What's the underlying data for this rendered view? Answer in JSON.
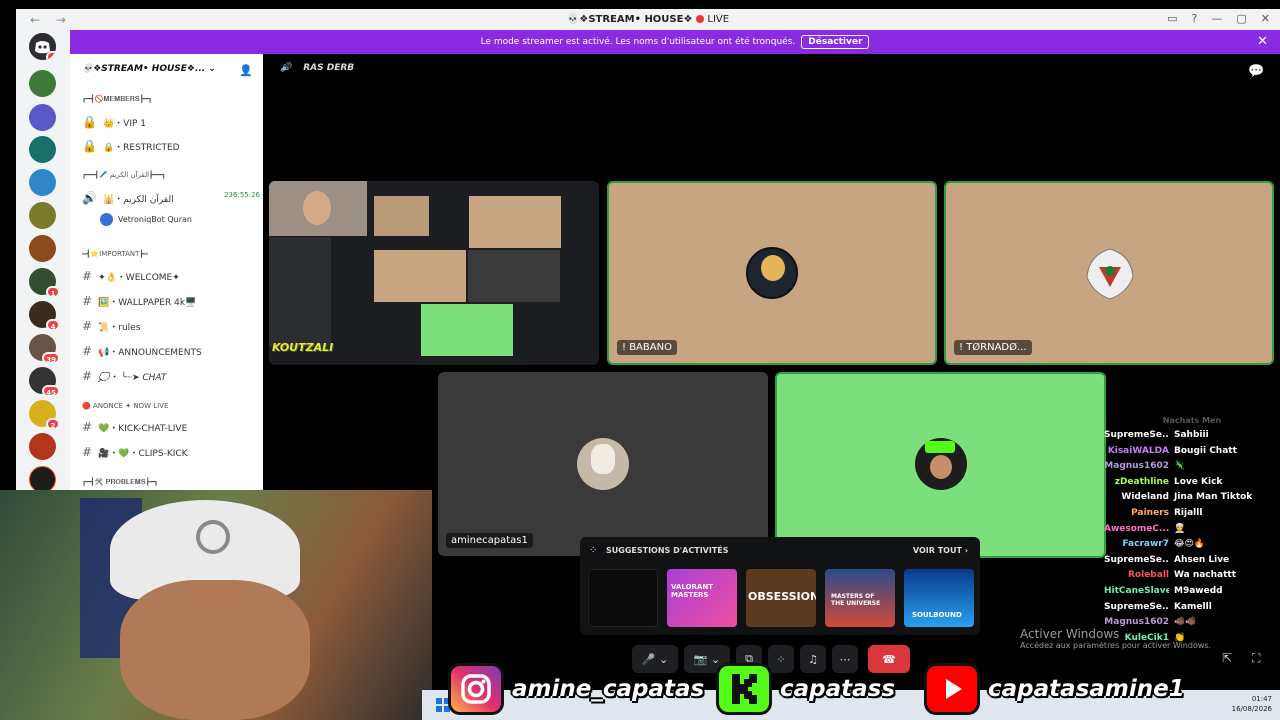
{
  "window": {
    "title": "💀❖STREAM• HOUSE❖",
    "live_label": "LIVE"
  },
  "banner": {
    "text": "Le mode streamer est activé. Les noms d'utilisateur ont été tronqués.",
    "button": "Désactiver"
  },
  "rail": {
    "badges": [
      "1",
      "1",
      "4",
      "39",
      "45",
      "2"
    ]
  },
  "server": {
    "name": "💀❖STREAM• HOUSE❖..."
  },
  "channels": [
    {
      "type": "category",
      "label": "┏━┫🚫𝐌𝐄𝐌𝐁𝐄𝐑𝐒┣━┓"
    },
    {
      "type": "locked",
      "label": "👑・VIP 1"
    },
    {
      "type": "locked",
      "label": "🔒・RESTRICTED"
    },
    {
      "type": "category",
      "label": "┏━━┫🖊️ القرآن الكريم┣━━┓"
    },
    {
      "type": "voice",
      "label": "🕌・القرآن الكريم",
      "timer": "236:55:26"
    },
    {
      "type": "member",
      "label": "VetroniqBot Quran"
    },
    {
      "type": "category",
      "label": "═┫⭐IMPORTANT┣═"
    },
    {
      "type": "text",
      "label": "✦👌・WELCOME✦"
    },
    {
      "type": "text",
      "label": "🖼️・WALLPAPER 4k🖥️"
    },
    {
      "type": "text",
      "label": "📜・rules"
    },
    {
      "type": "text",
      "label": "📢・ANNOUNCEMENTS"
    },
    {
      "type": "text",
      "label": "💭・ ╰┈➤ CHAT"
    },
    {
      "type": "category",
      "label": "🔴 ANONCE ✦ NOW LIVE"
    },
    {
      "type": "text",
      "label": "💚・KICK-CHAT-LIVE"
    },
    {
      "type": "text",
      "label": "🎥・💚・CLIPS-KICK"
    },
    {
      "type": "category",
      "label": "┏━┫🛠️ 𝐏𝐑𝐎𝐁𝐋𝐄𝐌𝐒┣━┓"
    }
  ],
  "voice": {
    "channel_name": "RAS DERB",
    "participants": [
      {
        "name": "! BABANO"
      },
      {
        "name": "! TØRNADØ..."
      },
      {
        "name": "aminecapatas1"
      }
    ],
    "stream_overlay_text": "KOUTZALI"
  },
  "activities": {
    "title": "SUGGESTIONS D'ACTIVITÉS",
    "see_all": "VOIR TOUT",
    "cards": [
      "VALORANT MASTERS",
      "OBSESSION",
      "MASTERS OF THE UNIVERSE",
      "SOULBOUND"
    ]
  },
  "chat_overlay": {
    "header": "Nachats Men",
    "messages": [
      {
        "user": "SupremeSe...",
        "color": "#ffffff",
        "msg": "Sahbiii"
      },
      {
        "user": "KisaiWALDA",
        "color": "#c77dff",
        "msg": "Bougii Chatt"
      },
      {
        "user": "Magnus1602",
        "color": "#b39ddb",
        "msg": "🦎"
      },
      {
        "user": "zDeathline",
        "color": "#a5ff4d",
        "msg": "Love Kick"
      },
      {
        "user": "Wideland",
        "color": "#ffffff",
        "msg": "Jina Man Tiktok"
      },
      {
        "user": "Painers",
        "color": "#ffab6e",
        "msg": "Rijalll"
      },
      {
        "user": "AwesomeC...",
        "color": "#ff6ec7",
        "msg": "👳"
      },
      {
        "user": "Facrawr7",
        "color": "#7fd3ff",
        "msg": "😂😍🔥"
      },
      {
        "user": "SupremeSe...",
        "color": "#ffffff",
        "msg": "Ahsen Live"
      },
      {
        "user": "Roleball",
        "color": "#ff5252",
        "msg": "Wa nachattt"
      },
      {
        "user": "HitCaneSlave",
        "color": "#69f0ae",
        "msg": "M9awedd"
      },
      {
        "user": "SupremeSe...",
        "color": "#ffffff",
        "msg": "Kamelll"
      },
      {
        "user": "Magnus1602",
        "color": "#b39ddb",
        "msg": "🐗🐗"
      },
      {
        "user": "KuleCik1",
        "color": "#69f0ae",
        "msg": "👏"
      }
    ]
  },
  "watermark": {
    "line1": "Activer Windows",
    "line2": "Accédez aux paramètres pour activer Windows."
  },
  "socials": {
    "instagram": "amine_capatas",
    "kick": "capatass",
    "youtube": "capatasamine1"
  },
  "taskbar": {
    "time": "01:47",
    "date": "16/08/2026"
  },
  "colors": {
    "banner": "#8a2be2",
    "speaking_border": "#7be07b",
    "tile_tan": "#c8a582",
    "kick_green": "#53fc18",
    "hangup": "#da373c"
  },
  "icons": [
    "discord-icon",
    "lock-icon",
    "speaker-icon",
    "hash-icon",
    "mic-icon",
    "camera-off-icon",
    "screen-share-icon",
    "activities-icon",
    "soundboard-icon",
    "more-icon",
    "hangup-icon",
    "chat-icon",
    "popout-icon",
    "fullscreen-icon",
    "windows-icon"
  ]
}
